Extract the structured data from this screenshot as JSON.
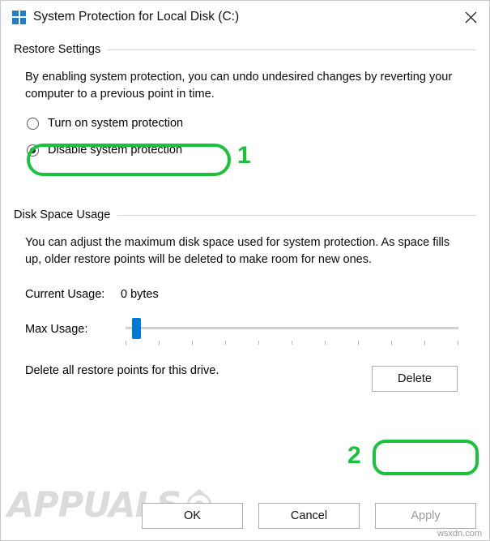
{
  "window": {
    "title": "System Protection for Local Disk (C:)",
    "logo_icon": "windows-logo-icon",
    "close_icon": "close-icon"
  },
  "restore_settings": {
    "group_title": "Restore Settings",
    "description": "By enabling system protection, you can undo undesired changes by reverting your computer to a previous point in time.",
    "options": [
      {
        "label": "Turn on system protection",
        "checked": false
      },
      {
        "label": "Disable system protection",
        "checked": true
      }
    ]
  },
  "disk_space_usage": {
    "group_title": "Disk Space Usage",
    "description": "You can adjust the maximum disk space used for system protection. As space fills up, older restore points will be deleted to make room for new ones.",
    "current_usage_label": "Current Usage:",
    "current_usage_value": "0 bytes",
    "max_usage_label": "Max Usage:",
    "slider_position_percent": 2
  },
  "delete_section": {
    "text": "Delete all restore points for this drive.",
    "button_label": "Delete"
  },
  "footer": {
    "ok_label": "OK",
    "cancel_label": "Cancel",
    "apply_label": "Apply"
  },
  "annotations": {
    "step_one": "1",
    "step_two": "2",
    "highlight_color": "#18c23a"
  },
  "watermark": {
    "brand": "APPUALS",
    "site": "wsxdn.com"
  }
}
